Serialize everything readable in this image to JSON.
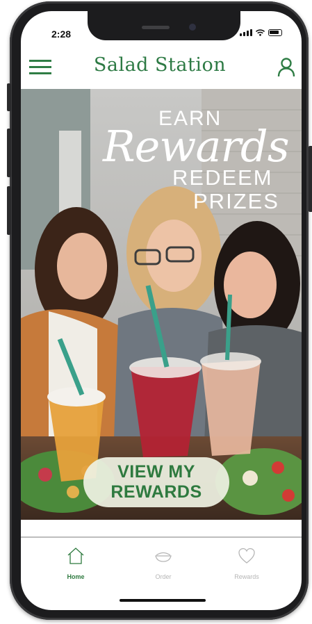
{
  "status_bar": {
    "time": "2:28"
  },
  "header": {
    "brand": "Salad Station"
  },
  "hero": {
    "line_earn": "EARN",
    "line_rewards": "Rewards",
    "line_redeem": "REDEEM",
    "line_prizes": "PRIZES",
    "cta_line1": "VIEW MY",
    "cta_line2": "REWARDS"
  },
  "tabbar": {
    "tabs": [
      {
        "label": "Home",
        "icon": "home-icon",
        "active": true
      },
      {
        "label": "Order",
        "icon": "salad-bowl-icon",
        "active": false
      },
      {
        "label": "Rewards",
        "icon": "heart-icon",
        "active": false
      }
    ]
  },
  "colors": {
    "brand_green": "#2d7a44",
    "active_tab": "#2e7a3f",
    "inactive_tab": "#b5b5b5"
  }
}
